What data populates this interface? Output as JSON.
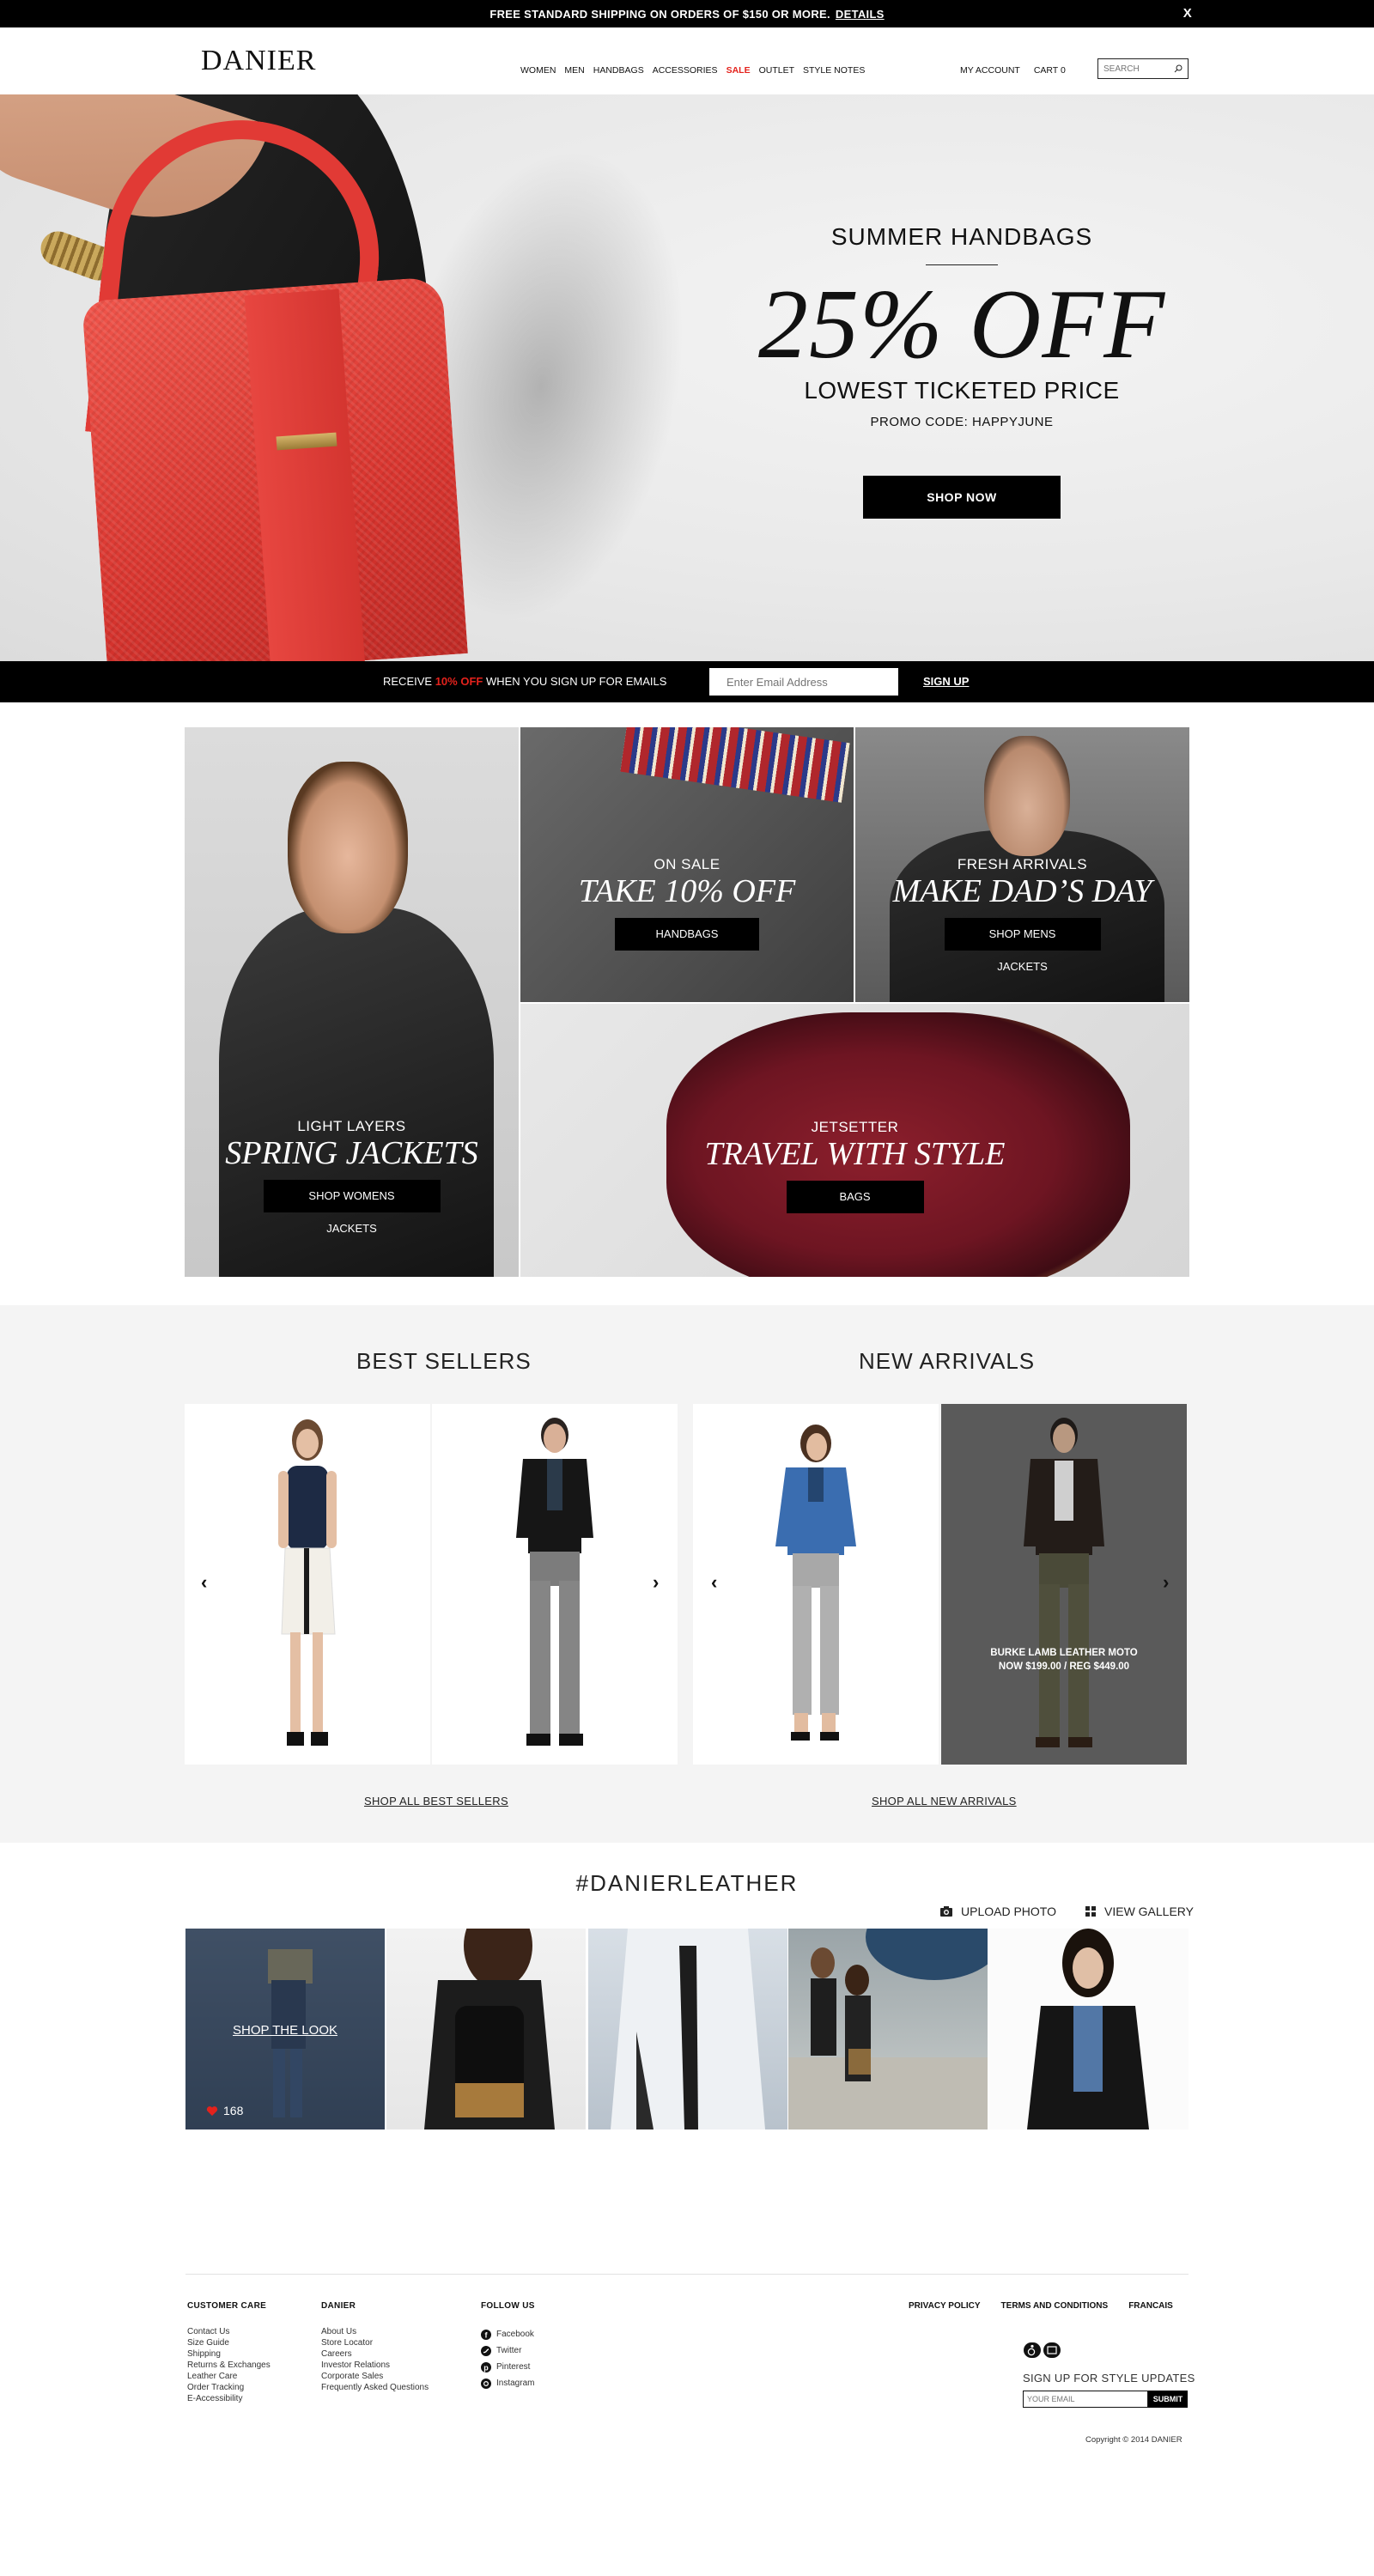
{
  "topbar": {
    "text": "FREE STANDARD SHIPPING ON ORDERS OF $150 OR MORE.",
    "details": "DETAILS",
    "close": "X"
  },
  "header": {
    "logo": "DANIER",
    "nav": [
      "WOMEN",
      "MEN",
      "HANDBAGS",
      "ACCESSORIES",
      "SALE",
      "OUTLET",
      "STYLE NOTES"
    ],
    "account": "MY ACCOUNT",
    "cart": "CART 0",
    "search_placeholder": "SEARCH"
  },
  "hero": {
    "subtitle": "SUMMER HANDBAGS",
    "headline": "25% OFF",
    "line": "LOWEST TICKETED PRICE",
    "promo": "PROMO CODE: HAPPYJUNE",
    "button": "SHOP NOW"
  },
  "emailbar": {
    "prefix": "RECEIVE",
    "highlight": "10% OFF",
    "suffix": "WHEN YOU SIGN UP FOR EMAILS",
    "placeholder": "Enter Email Address",
    "signup": "SIGN UP"
  },
  "promos": {
    "jackets": {
      "small": "LIGHT LAYERS",
      "big": "SPRING JACKETS",
      "button": "SHOP WOMENS JACKETS"
    },
    "sale": {
      "small": "ON SALE",
      "big": "TAKE 10% OFF",
      "button": "HANDBAGS"
    },
    "dads": {
      "small": "FRESH ARRIVALS",
      "big": "MAKE DAD’S DAY",
      "button": "SHOP MENS JACKETS"
    },
    "travel": {
      "small": "JETSETTER",
      "big": "TRAVEL WITH STYLE",
      "button": "BAGS"
    }
  },
  "products": {
    "best_sellers": {
      "title": "BEST SELLERS",
      "shop_all": "SHOP ALL BEST SELLERS"
    },
    "new_arrivals": {
      "title": "NEW ARRIVALS",
      "shop_all": "SHOP ALL NEW ARRIVALS",
      "hover_name": "BURKE LAMB LEATHER MOTO",
      "hover_price": "NOW $199.00 / REG $449.00"
    }
  },
  "gallery": {
    "title": "#DANIERLEATHER",
    "upload": "UPLOAD PHOTO",
    "view": "VIEW GALLERY",
    "shop_look": "SHOP THE LOOK",
    "likes": "168"
  },
  "footer": {
    "customer_care": {
      "title": "CUSTOMER CARE",
      "items": [
        "Contact Us",
        "Size Guide",
        "Shipping",
        "Returns & Exchanges",
        "Leather Care",
        "Order Tracking",
        "E-Accessibility"
      ]
    },
    "danier": {
      "title": "DANIER",
      "items": [
        "About Us",
        "Store Locator",
        "Careers",
        "Investor Relations",
        "Corporate Sales",
        "Frequently Asked Questions"
      ]
    },
    "follow": {
      "title": "FOLLOW US",
      "items": [
        "Facebook",
        "Twitter",
        "Pinterest",
        "Instagram"
      ]
    },
    "links": [
      "PRIVACY POLICY",
      "TERMS AND CONDITIONS",
      "FRANCAIS"
    ],
    "style_updates": "SIGN UP FOR STYLE UPDATES",
    "email_placeholder": "YOUR EMAIL",
    "submit": "SUBMIT",
    "copyright": "Copyright © 2014 DANIER"
  },
  "colors": {
    "accent_red": "#e4221c",
    "black": "#000000",
    "gray_bg": "#f4f4f4"
  }
}
